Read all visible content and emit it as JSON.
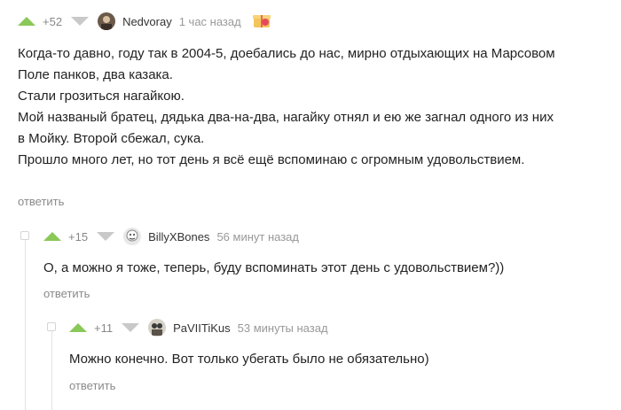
{
  "comments": [
    {
      "rating": "+52",
      "author": "Nedvoray",
      "time": "1 час назад",
      "avatar_icon": "user-avatar-icon",
      "gift_icon": "gift-icon",
      "lines": [
        "Когда-то давно, году так в 2004-5, доебались до нас, мирно отдыхающих на Марсовом",
        "Поле панков, два казака.",
        "Стали грозиться нагайкою.",
        "Мой названый братец, дядька два-на-два, нагайку отнял и ею же загнал одного из них",
        "в Мойку. Второй сбежал, сука.",
        "Прошло много лет, но тот день я всё ещё вспоминаю с огромным удовольствием."
      ],
      "reply_label": "ответить"
    },
    {
      "rating": "+15",
      "author": "BillyXBones",
      "time": "56 минут назад",
      "avatar_icon": "user-avatar-icon",
      "lines": [
        "О, а можно я тоже, теперь, буду вспоминать этот день с удовольствием?))"
      ],
      "reply_label": "ответить"
    },
    {
      "rating": "+11",
      "author": "PaVIITiKus",
      "time": "53 минуты назад",
      "avatar_icon": "user-avatar-icon",
      "lines": [
        "Можно конечно. Вот только убегать было не обязательно)"
      ],
      "reply_label": "ответить"
    }
  ],
  "colors": {
    "upvote": "#8ac858",
    "downvote": "#c9c9c9",
    "meta": "#999999",
    "reply": "#8a8a8a"
  }
}
